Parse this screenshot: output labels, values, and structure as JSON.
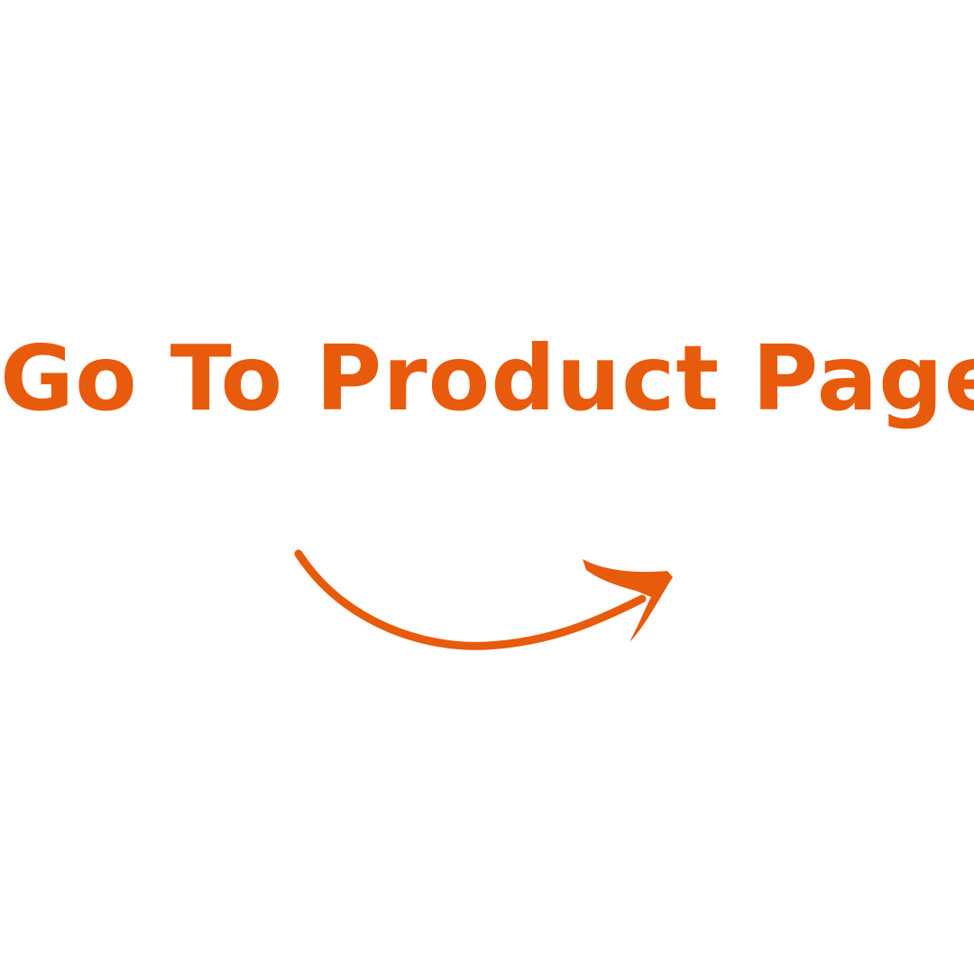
{
  "cta": {
    "label": "Go To Product Page"
  },
  "arrow": {
    "icon": "curved-arrow-right-icon"
  },
  "colors": {
    "accent": "#E85A0C",
    "background": "#FFFFFF"
  }
}
